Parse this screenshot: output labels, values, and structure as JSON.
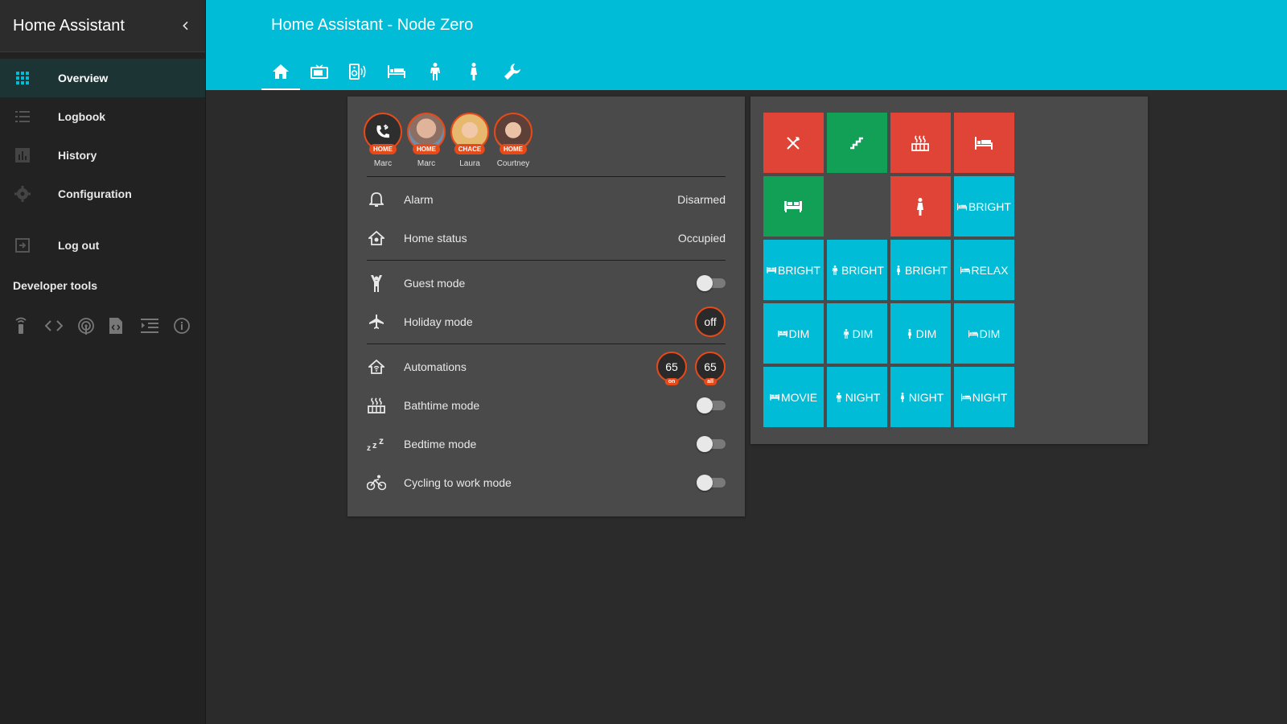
{
  "sidebar": {
    "title": "Home Assistant",
    "items": [
      {
        "label": "Overview",
        "icon": "apps-icon",
        "active": true
      },
      {
        "label": "Logbook",
        "icon": "list-icon"
      },
      {
        "label": "History",
        "icon": "chart-bar-icon"
      },
      {
        "label": "Configuration",
        "icon": "gear-icon"
      },
      {
        "label": "Log out",
        "icon": "exit-icon"
      }
    ],
    "developer_tools_title": "Developer tools",
    "developer_tools": [
      "remote-icon",
      "code-icon",
      "antenna-icon",
      "file-code-icon",
      "format-indent-icon",
      "info-icon"
    ]
  },
  "header": {
    "title": "Home Assistant - Node Zero",
    "tabs": [
      "home-icon",
      "tv-icon",
      "speaker-icon",
      "bed-icon",
      "man-icon",
      "woman-icon",
      "wrench-icon"
    ]
  },
  "people": [
    {
      "name": "Marc",
      "badge": "HOME",
      "icon": "phone-bluetooth-icon"
    },
    {
      "name": "Marc",
      "badge": "HOME"
    },
    {
      "name": "Laura",
      "badge": "CHACE"
    },
    {
      "name": "Courtney",
      "badge": "HOME"
    }
  ],
  "rows": {
    "alarm": {
      "name": "Alarm",
      "state": "Disarmed"
    },
    "home_status": {
      "name": "Home status",
      "state": "Occupied"
    },
    "guest_mode": {
      "name": "Guest mode"
    },
    "holiday_mode": {
      "name": "Holiday mode",
      "state": "off"
    },
    "automations": {
      "name": "Automations",
      "on_count": "65",
      "on_label": "on",
      "all_count": "65",
      "all_label": "all"
    },
    "bathtime_mode": {
      "name": "Bathtime mode"
    },
    "bedtime_mode": {
      "name": "Bedtime mode"
    },
    "cycling_mode": {
      "name": "Cycling to work mode"
    }
  },
  "tiles": [
    {
      "color": "red",
      "icon": "silverware-icon",
      "label": ""
    },
    {
      "color": "green",
      "icon": "stairs-icon",
      "label": ""
    },
    {
      "color": "red",
      "icon": "hot-tub-icon",
      "label": ""
    },
    {
      "color": "red",
      "icon": "bed-icon",
      "label": ""
    },
    {
      "color": "green",
      "icon": "sofa-icon",
      "label": ""
    },
    {
      "color": "empty",
      "icon": "",
      "label": ""
    },
    {
      "color": "red",
      "icon": "woman-icon",
      "label": ""
    },
    {
      "color": "cyan",
      "icon": "bed-icon",
      "label": "BRIGHT"
    },
    {
      "color": "cyan",
      "icon": "sofa-icon",
      "label": "BRIGHT"
    },
    {
      "color": "cyan",
      "icon": "man-icon",
      "label": "BRIGHT"
    },
    {
      "color": "cyan",
      "icon": "woman-icon",
      "label": "BRIGHT"
    },
    {
      "color": "cyan",
      "icon": "bed-icon",
      "label": "RELAX"
    },
    {
      "color": "cyan",
      "icon": "sofa-icon",
      "label": "DIM"
    },
    {
      "color": "cyan",
      "icon": "man-icon",
      "label": "DIM"
    },
    {
      "color": "cyan",
      "icon": "woman-icon",
      "label": "DIM"
    },
    {
      "color": "cyan",
      "icon": "bed-icon",
      "label": "DIM"
    },
    {
      "color": "cyan",
      "icon": "sofa-icon",
      "label": "MOVIE"
    },
    {
      "color": "cyan",
      "icon": "man-icon",
      "label": "NIGHT"
    },
    {
      "color": "cyan",
      "icon": "woman-icon",
      "label": "NIGHT"
    },
    {
      "color": "cyan",
      "icon": "bed-icon",
      "label": "NIGHT"
    }
  ],
  "colors": {
    "accent": "#00bcd6",
    "red": "#e04436",
    "green": "#11a055",
    "badge": "#e64a19"
  }
}
